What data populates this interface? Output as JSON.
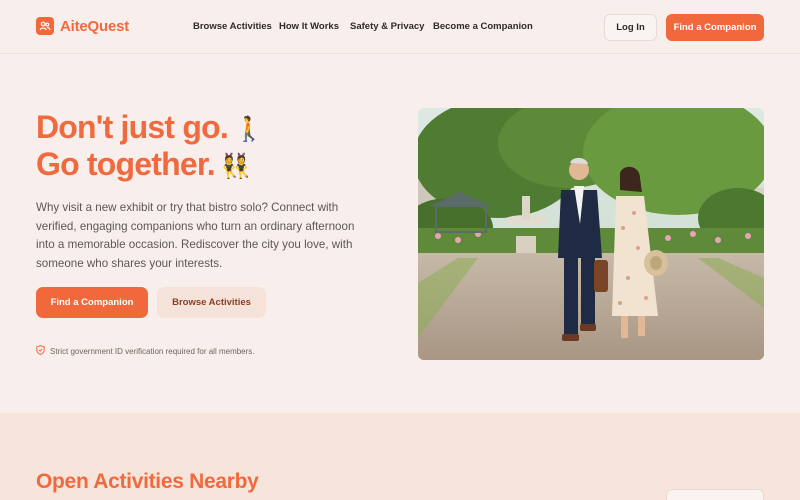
{
  "brand": {
    "name": "AiteQuest",
    "accent": "#f0683c"
  },
  "nav": {
    "items": [
      "Browse Activities",
      "How It Works",
      "Safety & Privacy",
      "Become a Companion"
    ]
  },
  "header": {
    "login_label": "Log In",
    "cta_label": "Find a Companion"
  },
  "hero": {
    "title_line1": "Don't just go.",
    "title_line2": "Go together.",
    "emoji_1": "🚶",
    "emoji_2": "👯",
    "description": "Why visit a new exhibit or try that bistro solo? Connect with verified, engaging companions who turn an ordinary afternoon into a memorable occasion. Rediscover the city you love, with someone who shares your interests.",
    "primary_label": "Find a Companion",
    "secondary_label": "Browse Activities",
    "verification_note": "Strict government ID verification required for all members.",
    "image_icon": "park-couple-photo"
  },
  "activities": {
    "title": "Open Activities Nearby"
  }
}
